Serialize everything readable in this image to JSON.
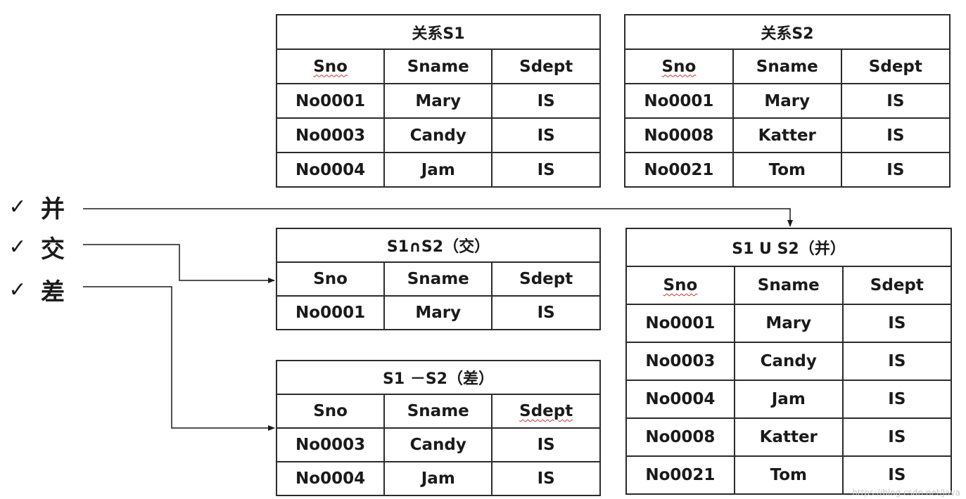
{
  "columns": [
    "Sno",
    "Sname",
    "Sdept"
  ],
  "s1": {
    "title": "关系S1",
    "rows": [
      [
        "No0001",
        "Mary",
        "IS"
      ],
      [
        "No0003",
        "Candy",
        "IS"
      ],
      [
        "No0004",
        "Jam",
        "IS"
      ]
    ]
  },
  "s2": {
    "title": "关系S2",
    "rows": [
      [
        "No0001",
        "Mary",
        "IS"
      ],
      [
        "No0008",
        "Katter",
        "IS"
      ],
      [
        "No0021",
        "Tom",
        "IS"
      ]
    ]
  },
  "intersection": {
    "title": "S1∩S2（交）",
    "rows": [
      [
        "No0001",
        "Mary",
        "IS"
      ]
    ]
  },
  "difference": {
    "title": "S1 －S2（差）",
    "rows": [
      [
        "No0003",
        "Candy",
        "IS"
      ],
      [
        "No0004",
        "Jam",
        "IS"
      ]
    ]
  },
  "union": {
    "title": "S1 U S2（并）",
    "rows": [
      [
        "No0001",
        "Mary",
        "IS"
      ],
      [
        "No0003",
        "Candy",
        "IS"
      ],
      [
        "No0004",
        "Jam",
        "IS"
      ],
      [
        "No0008",
        "Katter",
        "IS"
      ],
      [
        "No0021",
        "Tom",
        "IS"
      ]
    ]
  },
  "operations": [
    {
      "check": "✓",
      "label": "并"
    },
    {
      "check": "✓",
      "label": "交"
    },
    {
      "check": "✓",
      "label": "差"
    }
  ],
  "watermark": "https://blog.csdn.net/Java"
}
